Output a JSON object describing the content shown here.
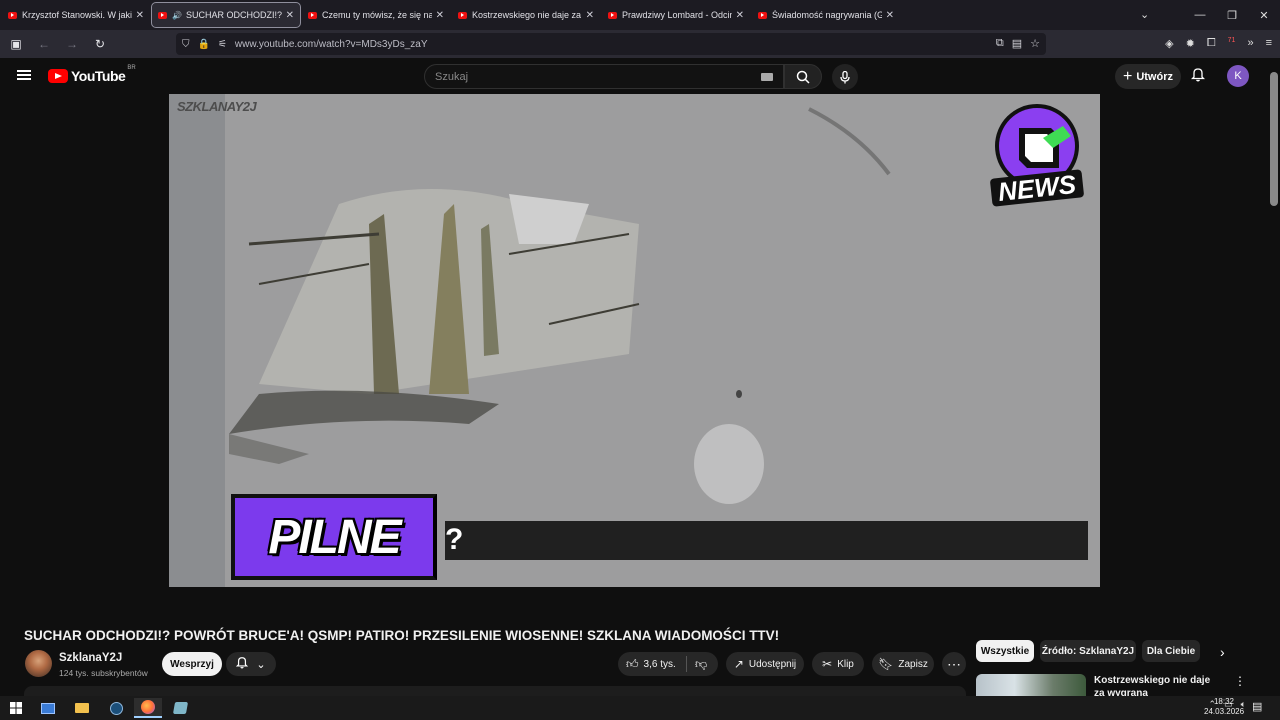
{
  "browser": {
    "tabs": [
      {
        "title": "Krzysztof Stanowski. W jakiej sp",
        "active": false,
        "audio": false
      },
      {
        "title": "SUCHAR ODCHODZI!? POW",
        "active": true,
        "audio": true
      },
      {
        "title": "Czemu ty mówisz, że się na ciel",
        "active": false,
        "audio": false
      },
      {
        "title": "Kostrzewskiego nie daje za wyg",
        "active": false,
        "audio": false
      },
      {
        "title": "Prawdziwy Lombard - Odcinek",
        "active": false,
        "audio": false
      },
      {
        "title": "Świadomość nagrywania (Giełd",
        "active": false,
        "audio": false
      }
    ],
    "url": "www.youtube.com/watch?v=MDs3yDs_zaY",
    "extension_badge": "71"
  },
  "youtube": {
    "logo_text": "YouTube",
    "region": "BR",
    "search_placeholder": "Szukaj",
    "create_label": "Utwórz",
    "avatar_letter": "K"
  },
  "video": {
    "watermark": "SZKLANAY2J",
    "news_logo_text": "NEWS",
    "banner_text": "PILNE",
    "ticker_text": "?",
    "title": "SUCHAR ODCHODZI!? POWRÓT BRUCE'A! QSMP! PATIRO! PRZESILENIE WIOSENNE! SZKLANA WIADOMOŚCI TTV!",
    "channel_name": "SzklanaY2J",
    "subscribers": "124 tys. subskrybentów",
    "support_label": "Wesprzyj",
    "likes": "3,6 tys.",
    "share_label": "Udostępnij",
    "clip_label": "Klip",
    "save_label": "Zapisz"
  },
  "sidebar": {
    "chips": [
      "Wszystkie",
      "Źródło: SzklanaY2J",
      "Dla Ciebie"
    ],
    "recommendation_title": "Kostrzewskiego nie daje za wygraną"
  },
  "taskbar": {
    "time": "18:32",
    "date": "24.03.2026"
  },
  "colors": {
    "youtube_red": "#ff0000",
    "banner_purple": "#7c3aed",
    "avatar_purple": "#7e57c2"
  }
}
